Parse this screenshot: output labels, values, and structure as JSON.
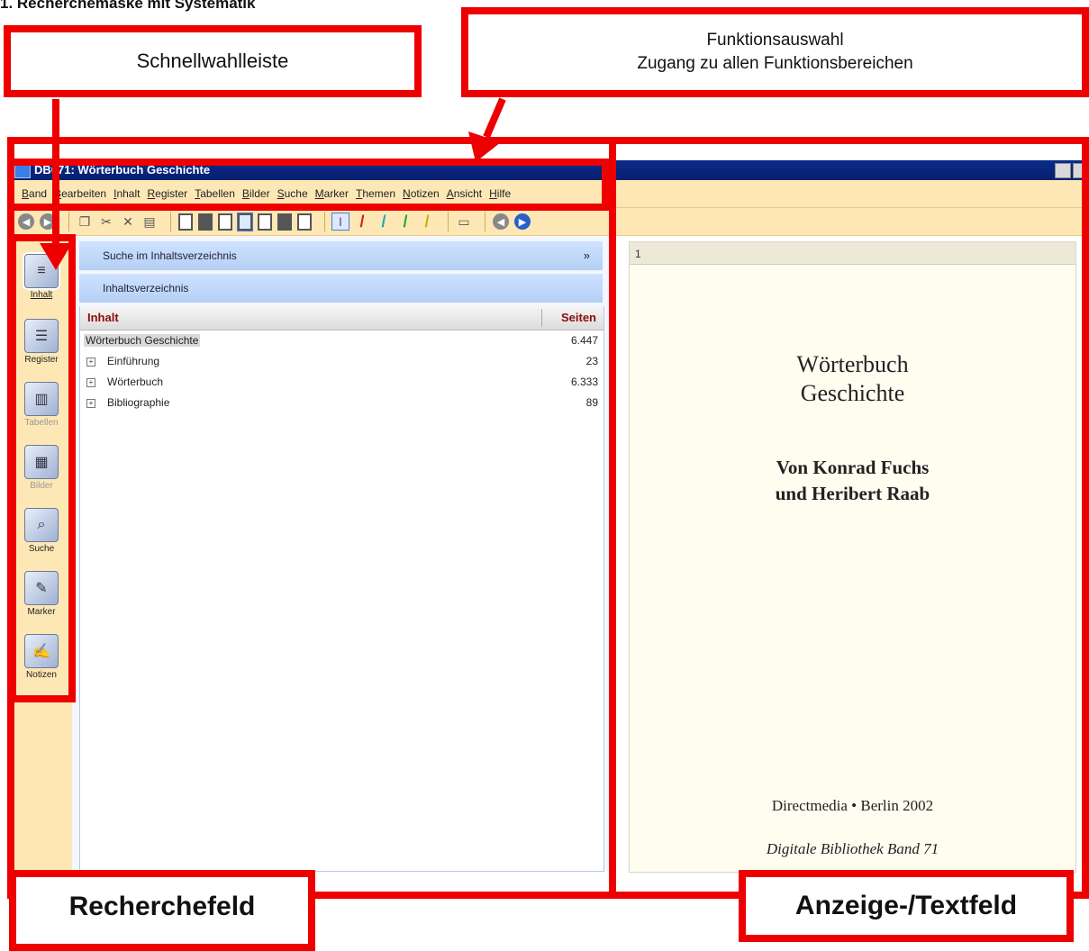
{
  "heading": "1. Recherchemaske mit Systematik",
  "callouts": {
    "schnellwahl": "Schnellwahlleiste",
    "funktion_line1": "Funktionsauswahl",
    "funktion_line2": "Zugang zu allen Funktionsbereichen",
    "recherchefeld": "Recherchefeld",
    "anzeigefeld": "Anzeige-/Textfeld"
  },
  "window": {
    "title": "DB071: Wörterbuch Geschichte"
  },
  "menu": [
    "Band",
    "Bearbeiten",
    "Inhalt",
    "Register",
    "Tabellen",
    "Bilder",
    "Suche",
    "Marker",
    "Themen",
    "Notizen",
    "Ansicht",
    "Hilfe"
  ],
  "sidebar": {
    "items": [
      {
        "label": "Inhalt",
        "icon": "contents-icon"
      },
      {
        "label": "Register",
        "icon": "register-icon"
      },
      {
        "label": "Tabellen",
        "icon": "tables-icon"
      },
      {
        "label": "Bilder",
        "icon": "images-icon"
      },
      {
        "label": "Suche",
        "icon": "search-icon"
      },
      {
        "label": "Marker",
        "icon": "marker-icon"
      },
      {
        "label": "Notizen",
        "icon": "notes-icon"
      }
    ]
  },
  "panel": {
    "search_header": "Suche im Inhaltsverzeichnis",
    "toc_header": "Inhaltsverzeichnis",
    "col_content": "Inhalt",
    "col_pages": "Seiten",
    "rows": [
      {
        "label": "Wörterbuch Geschichte",
        "pages": "6.447"
      },
      {
        "label": "Einführung",
        "pages": "23"
      },
      {
        "label": "Wörterbuch",
        "pages": "6.333"
      },
      {
        "label": "Bibliographie",
        "pages": "89"
      }
    ]
  },
  "page": {
    "number": "1",
    "title_line1": "Wörterbuch",
    "title_line2": "Geschichte",
    "author_line1": "Von Konrad Fuchs",
    "author_line2": "und Heribert Raab",
    "publisher": "Directmedia • Berlin 2002",
    "series": "Digitale Bibliothek Band 71"
  },
  "colors": {
    "callout_border": "#ee0000",
    "titlebar": "#0b2a8c",
    "bar_background": "#fde8b5",
    "column_header_text": "#8b0a0a"
  }
}
